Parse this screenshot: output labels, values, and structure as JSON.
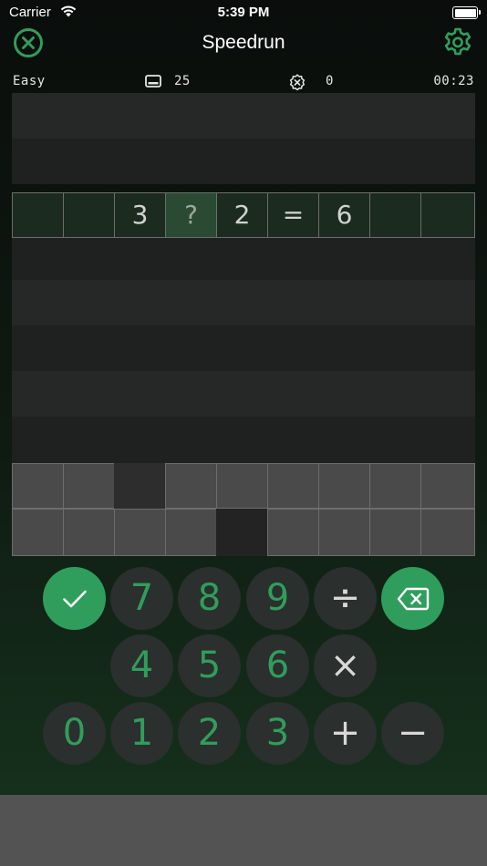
{
  "status_bar": {
    "carrier": "Carrier",
    "time": "5:39 PM"
  },
  "nav": {
    "title": "Speedrun"
  },
  "info": {
    "difficulty": "Easy",
    "remaining": "25",
    "mistakes": "0",
    "timer": "00:23"
  },
  "board": {
    "active_row": {
      "cells": [
        "",
        "",
        "3",
        "?",
        "2",
        "=",
        "6",
        "",
        ""
      ],
      "selected_index": 3
    }
  },
  "keypad": {
    "row1": [
      "✓",
      "7",
      "8",
      "9",
      "÷",
      "⌫"
    ],
    "row2": [
      "4",
      "5",
      "6",
      "×"
    ],
    "row3": [
      "0",
      "1",
      "2",
      "3",
      "+",
      "−"
    ]
  },
  "colors": {
    "accent": "#2f9e5c",
    "background": "#0b100c",
    "tile": "#4a4a4a"
  }
}
